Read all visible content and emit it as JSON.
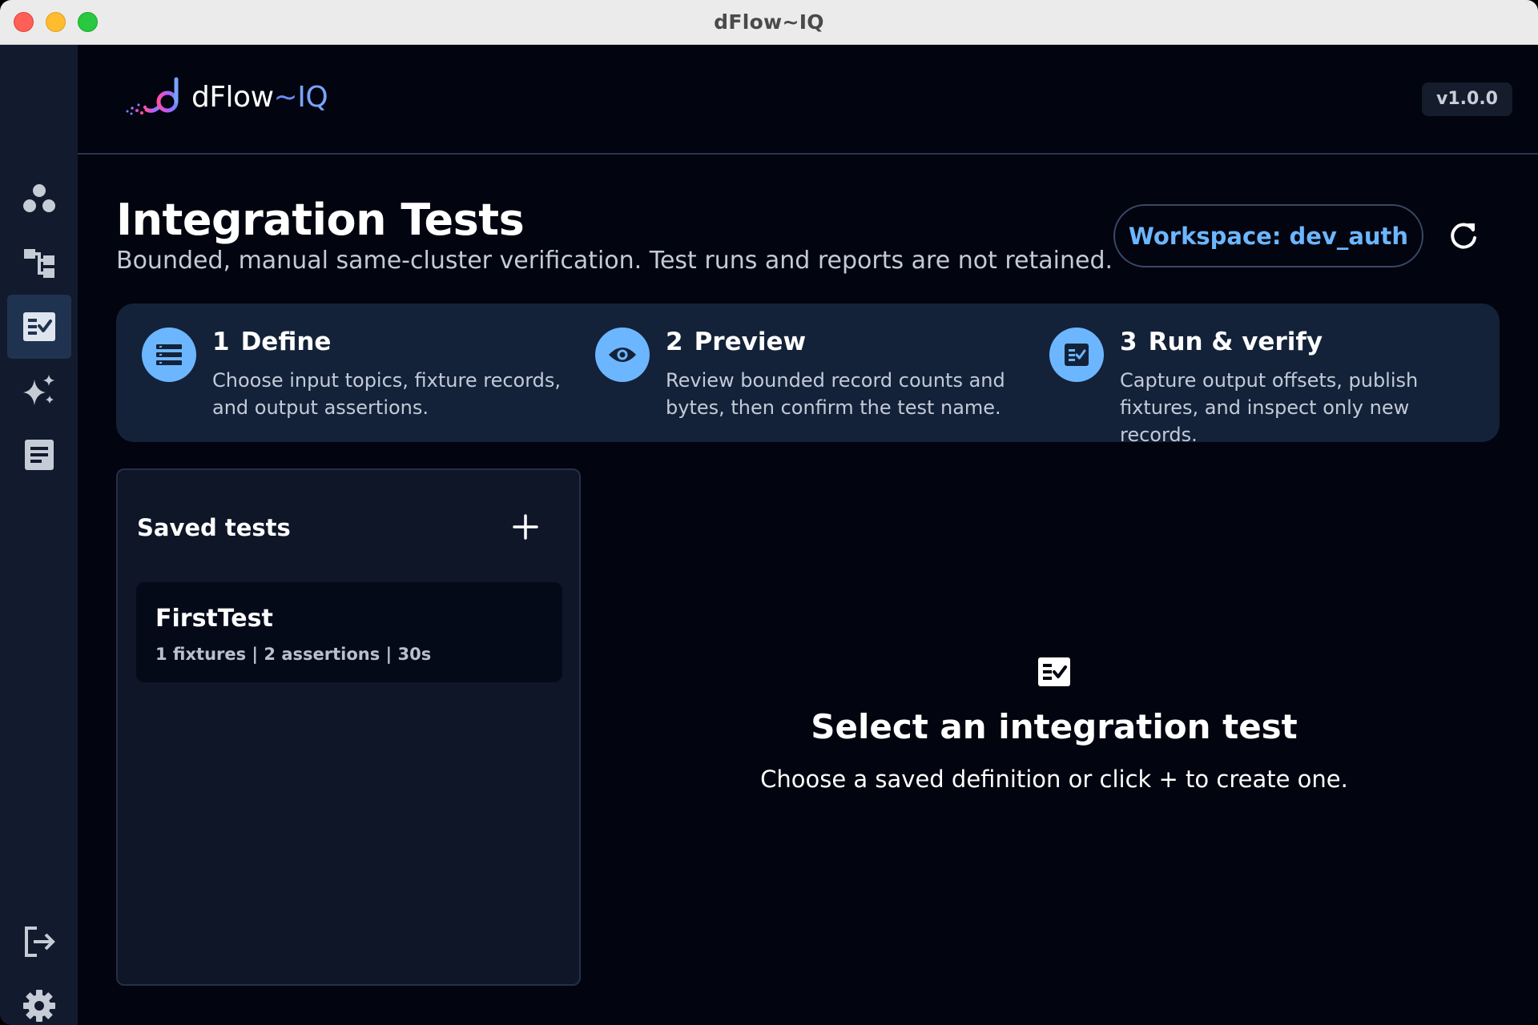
{
  "window": {
    "title": "dFlow~IQ"
  },
  "app": {
    "logo_main": "dFlow",
    "logo_tilde": "~",
    "logo_iq": "IQ",
    "version": "v1.0.0"
  },
  "sidebar": {
    "items": [
      {
        "icon": "cluster-icon",
        "active": false
      },
      {
        "icon": "topology-icon",
        "active": false
      },
      {
        "icon": "checklist-icon",
        "active": true
      },
      {
        "icon": "sparkles-icon",
        "active": false
      },
      {
        "icon": "document-icon",
        "active": false
      }
    ],
    "bottom": [
      {
        "icon": "logout-icon"
      },
      {
        "icon": "gear-icon"
      }
    ]
  },
  "page": {
    "title": "Integration Tests",
    "subtitle": "Bounded, manual same-cluster verification. Test runs and reports are not retained.",
    "workspace_label": "Workspace: dev_auth"
  },
  "steps": [
    {
      "num": "1",
      "title": "Define",
      "desc": "Choose input topics, fixture records, and output assertions.",
      "icon": "list-icon"
    },
    {
      "num": "2",
      "title": "Preview",
      "desc": "Review bounded record counts and bytes, then confirm the test name.",
      "icon": "eye-icon"
    },
    {
      "num": "3",
      "title": "Run & verify",
      "desc": "Capture output offsets, publish fixtures, and inspect only new records.",
      "icon": "checklist-icon"
    }
  ],
  "saved": {
    "title": "Saved tests",
    "tests": [
      {
        "name": "FirstTest",
        "meta": "1 fixtures | 2 assertions | 30s"
      }
    ]
  },
  "empty": {
    "title": "Select an integration test",
    "desc": "Choose a saved definition or click + to create one."
  },
  "colors": {
    "accent": "#6cb6ff",
    "background": "#02040f",
    "sidebar": "#121a2e",
    "panel": "#132239"
  }
}
